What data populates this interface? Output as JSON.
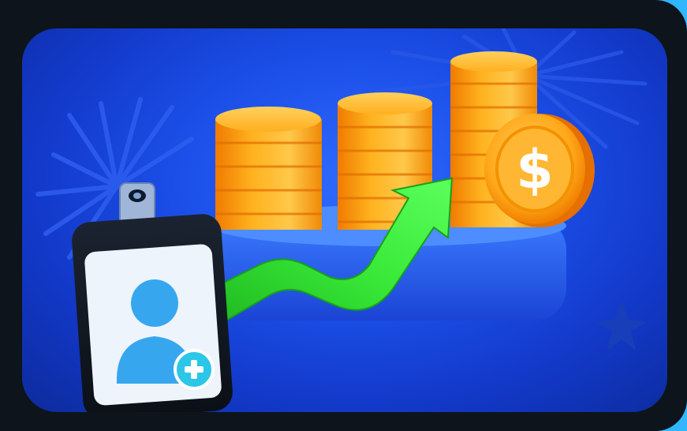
{
  "colors": {
    "background": "#0d141b",
    "accent_strip": "#31b7ff",
    "scene_blue": "#1b4fe8",
    "coin_orange": "#ffad1f",
    "arrow_green": "#32e632",
    "badge_blue": "#36a7ef",
    "plus_badge": "#2bc6e8"
  },
  "illustration": {
    "coin_symbol": "$"
  }
}
